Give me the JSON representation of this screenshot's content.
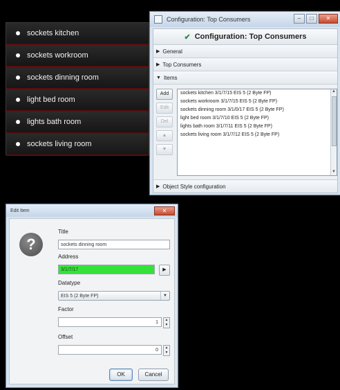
{
  "consumers": [
    "sockets kitchen",
    "sockets workroom",
    "sockets dinning room",
    "light bed room",
    "lights bath room",
    "sockets living room"
  ],
  "config_window": {
    "title": "Configuration: Top Consumers",
    "header": "Configuration: Top Consumers",
    "sections": {
      "general": "General",
      "top_consumers": "Top Consumers",
      "items": "Items",
      "object_style": "Object Style configuration"
    },
    "buttons": {
      "add": "Add",
      "edit": "Edit",
      "del": "Del",
      "up": "▲",
      "down": "▼"
    },
    "items": [
      "sockets kitchen 3/1/7/15 EIS 5 (2 Byte FP)",
      "sockets workroom 3/1/7/15 EIS 5 (2 Byte FP)",
      "sockets dinning room 3/1/0/17 EIS 5 (2 Byte FP)",
      "light bed room 3/1/7/10 EIS 5 (2 Byte FP)",
      "lights bath room 3/1/7/11 EIS 5 (2 Byte FP)",
      "sockets living room 3/1/7/12 EIS 5 (2 Byte FP)"
    ]
  },
  "edit_dialog": {
    "title": "Edit Item",
    "title_label": "Title",
    "title_value": "sockets dinning room",
    "address_label": "Address",
    "address_value": "3/1/7/17",
    "datatype_label": "Datatype",
    "datatype_value": "EIS 5 (2 Byte FP)",
    "factor_label": "Factor",
    "factor_value": "1",
    "offset_label": "Offset",
    "offset_value": "0",
    "ok": "OK",
    "cancel": "Cancel",
    "help_glyph": "?"
  },
  "colors": {
    "address_ok": "#36e23a",
    "list_separator": "#5a0d0d",
    "window_frame": "#d8e4ef"
  }
}
